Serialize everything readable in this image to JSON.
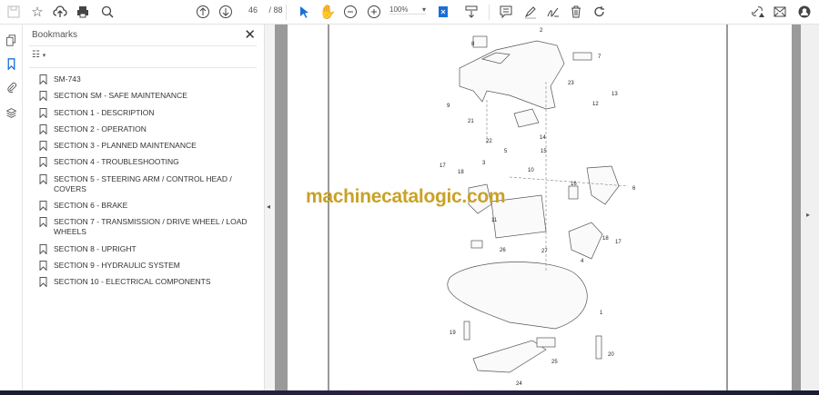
{
  "toolbar": {
    "page_current": "46",
    "page_total": "/ 88",
    "zoom": "100%",
    "icons": [
      "save-icon",
      "bookmark-star-icon",
      "upload-cloud-icon",
      "print-icon",
      "search-icon",
      "prev-page-icon",
      "next-page-icon",
      "select-cursor-icon",
      "hand-icon",
      "zoom-out-icon",
      "zoom-in-icon",
      "fit-page-icon",
      "scroll-mode-icon",
      "comment-icon",
      "highlight-pen-icon",
      "sign-icon",
      "delete-icon",
      "rotate-icon",
      "share-link-icon",
      "email-icon",
      "account-icon"
    ]
  },
  "sidebar": {
    "title": "Bookmarks",
    "close": "✕",
    "items": [
      {
        "label": "SM-743"
      },
      {
        "label": "SECTION SM - SAFE MAINTENANCE"
      },
      {
        "label": "SECTION 1 - DESCRIPTION"
      },
      {
        "label": "SECTION 2 - OPERATION"
      },
      {
        "label": "SECTION 3 - PLANNED MAINTENANCE"
      },
      {
        "label": "SECTION 4 - TROUBLESHOOTING"
      },
      {
        "label": "SECTION 5 - STEERING ARM / CONTROL HEAD / COVERS"
      },
      {
        "label": "SECTION 6 - BRAKE"
      },
      {
        "label": "SECTION 7 - TRANSMISSION / DRIVE WHEEL / LOAD WHEELS"
      },
      {
        "label": "SECTION 8 - UPRIGHT"
      },
      {
        "label": "SECTION 9 - HYDRAULIC SYSTEM"
      },
      {
        "label": "SECTION 10 - ELECTRICAL COMPONENTS"
      }
    ]
  },
  "document": {
    "watermark": "machinecatalogic.com",
    "callouts": [
      "2",
      "8",
      "7",
      "23",
      "13",
      "12",
      "9",
      "21",
      "14",
      "22",
      "5",
      "15",
      "17",
      "3",
      "18",
      "10",
      "16",
      "6",
      "11",
      "18",
      "17",
      "26",
      "27",
      "4",
      "1",
      "19",
      "20",
      "25",
      "24"
    ]
  },
  "colors": {
    "accent": "#1a6fd6",
    "watermark": "#c9a227"
  }
}
